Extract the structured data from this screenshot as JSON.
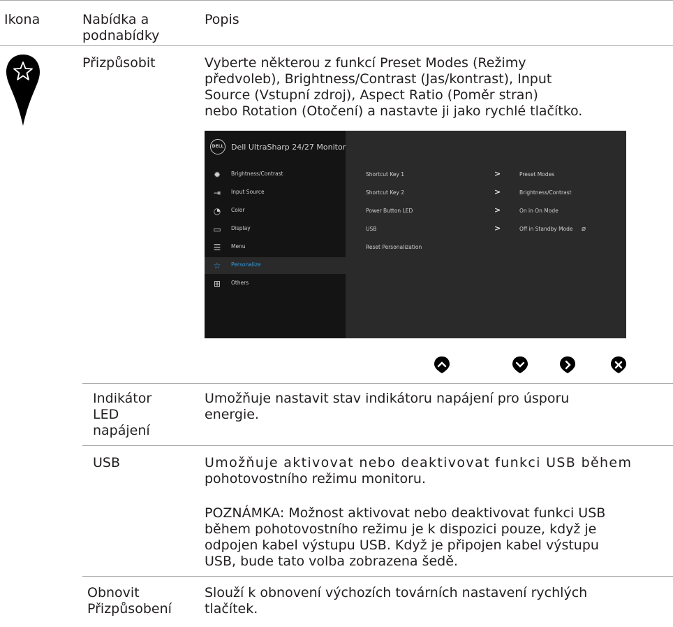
{
  "header": {
    "col_icon": "Ikona",
    "col_menu": "Nabídka a podnabídky",
    "col_desc": "Popis"
  },
  "row_main": {
    "menu": "Přizpůsobit",
    "icon": "star-icon",
    "desc_lines": [
      "Vyberte některou z funkcí Preset Modes (Režimy",
      "předvoleb), Brightness/Contrast (Jas/kontrast), Input",
      "Source (Vstupní zdroj), Aspect Ratio (Poměr stran)",
      "nebo Rotation (Otočení) a nastavte ji jako rychlé tlačítko."
    ]
  },
  "osd": {
    "title": "Dell UltraSharp 24/27 Monitor",
    "logo": "DELL",
    "menu": [
      {
        "label": "Brightness/Contrast",
        "icon": "sun-icon"
      },
      {
        "label": "Input Source",
        "icon": "input-icon"
      },
      {
        "label": "Color",
        "icon": "palette-icon"
      },
      {
        "label": "Display",
        "icon": "display-icon"
      },
      {
        "label": "Menu",
        "icon": "menu-icon"
      },
      {
        "label": "Personalize",
        "icon": "star-icon",
        "selected": true
      },
      {
        "label": "Others",
        "icon": "others-icon"
      }
    ],
    "rows": [
      {
        "label": "Shortcut Key 1",
        "value": "Preset Modes"
      },
      {
        "label": "Shortcut Key 2",
        "value": "Brightness/Contrast"
      },
      {
        "label": "Power Button LED",
        "value": "On in On Mode"
      },
      {
        "label": "USB",
        "value": "Off in Standby Mode"
      },
      {
        "label": "Reset Personalization",
        "value": ""
      }
    ],
    "accent": "#2f9be0",
    "buttons": [
      "up-button",
      "down-button",
      "right-button",
      "close-button"
    ]
  },
  "rows": [
    {
      "menu_lines": [
        "Indikátor",
        "LED",
        "napájení"
      ],
      "desc_lines": [
        "Umožňuje nastavit stav indikátoru napájení pro úsporu",
        "energie."
      ]
    },
    {
      "menu_lines": [
        "USB"
      ],
      "desc_lines": [
        "Umožňuje aktivovat nebo deaktivovat funkci USB během",
        "pohotovostního režimu monitoru."
      ],
      "note_lines": [
        "POZNÁMKA: Možnost aktivovat nebo deaktivovat funkci USB",
        "během pohotovostního režimu je k dispozici pouze, když je",
        "odpojen kabel výstupu USB. Když je připojen kabel výstupu",
        "USB, bude tato volba zobrazena šedě."
      ]
    },
    {
      "menu_lines": [
        "Obnovit",
        "Přizpůsobení"
      ],
      "desc_lines": [
        "Slouží k obnovení výchozích továrních nastavení rychlých",
        "tlačítek."
      ]
    }
  ]
}
